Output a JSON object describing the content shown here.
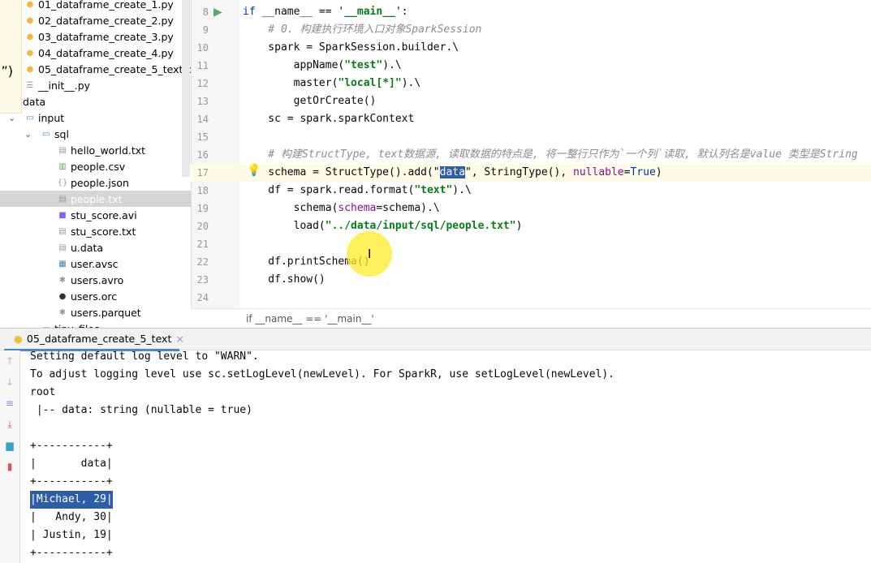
{
  "tree": [
    {
      "label": "01_dataframe_create_1.py",
      "icon": "python-file-icon",
      "indent": 30
    },
    {
      "label": "02_dataframe_create_2.py",
      "icon": "python-file-icon",
      "indent": 30
    },
    {
      "label": "03_dataframe_create_3.py",
      "icon": "python-file-icon",
      "indent": 30
    },
    {
      "label": "04_dataframe_create_4.py",
      "icon": "python-file-icon",
      "indent": 30
    },
    {
      "label": "05_dataframe_create_5_text.py",
      "icon": "python-file-icon",
      "indent": 30
    },
    {
      "label": "__init__.py",
      "icon": "init-file-icon",
      "indent": 30
    },
    {
      "label": "data",
      "icon": "",
      "indent": 28
    },
    {
      "label": "input",
      "icon": "folder-icon",
      "indent": 30,
      "expanded": true
    },
    {
      "label": "sql",
      "icon": "folder-icon",
      "indent": 50,
      "expanded": true
    },
    {
      "label": "hello_world.txt",
      "icon": "text-file-icon",
      "indent": 70
    },
    {
      "label": "people.csv",
      "icon": "csv-file-icon",
      "indent": 70
    },
    {
      "label": "people.json",
      "icon": "json-file-icon",
      "indent": 70
    },
    {
      "label": "people.txt",
      "icon": "text-file-icon",
      "indent": 70,
      "selected": true
    },
    {
      "label": "stu_score.avi",
      "icon": "video-file-icon",
      "indent": 70
    },
    {
      "label": "stu_score.txt",
      "icon": "text-file-icon",
      "indent": 70
    },
    {
      "label": "u.data",
      "icon": "text-file-icon",
      "indent": 70
    },
    {
      "label": "user.avsc",
      "icon": "avsc-file-icon",
      "indent": 70
    },
    {
      "label": "users.avro",
      "icon": "asterisk-file-icon",
      "indent": 70
    },
    {
      "label": "users.orc",
      "icon": "orc-file-icon",
      "indent": 70
    },
    {
      "label": "users.parquet",
      "icon": "asterisk-file-icon",
      "indent": 70
    },
    {
      "label": "tiny_files",
      "icon": "folder-icon",
      "indent": 50
    }
  ],
  "popup_text": "”)",
  "code": [
    {
      "n": "8",
      "t": [
        [
          "kw",
          "if "
        ],
        [
          "",
          "__name__ == "
        ],
        [
          "str",
          "'__main__'"
        ],
        [
          "",
          ":"
        ]
      ]
    },
    {
      "n": "9",
      "t": [
        [
          "cm",
          "    # 0. 构建执行环境入口对象SparkSession"
        ]
      ]
    },
    {
      "n": "10",
      "t": [
        [
          "",
          "    spark = SparkSession.builder.\\"
        ]
      ]
    },
    {
      "n": "11",
      "t": [
        [
          "",
          "        appName("
        ],
        [
          "str",
          "\"test\""
        ],
        [
          "",
          ").\\"
        ]
      ]
    },
    {
      "n": "12",
      "t": [
        [
          "",
          "        master("
        ],
        [
          "str",
          "\"local[*]\""
        ],
        [
          "",
          ").\\"
        ]
      ]
    },
    {
      "n": "13",
      "t": [
        [
          "",
          "        getOrCreate()"
        ]
      ]
    },
    {
      "n": "14",
      "t": [
        [
          "",
          "    sc = spark.sparkContext"
        ]
      ]
    },
    {
      "n": "15",
      "t": []
    },
    {
      "n": "16",
      "t": [
        [
          "cm",
          "    # 构建StructType, text数据源, 读取数据的特点是, 将一整行只作为`一个列`读取, 默认列名是value 类型是String"
        ]
      ]
    },
    {
      "n": "17",
      "t": [
        [
          "",
          "    schema = StructType().add(\""
        ],
        [
          "sel",
          "data"
        ],
        [
          "",
          "\", StringType(), "
        ],
        [
          "pr",
          "nullable"
        ],
        [
          "",
          "="
        ],
        [
          "kw",
          "True"
        ],
        [
          "",
          ")"
        ]
      ],
      "hl": true
    },
    {
      "n": "18",
      "t": [
        [
          "",
          "    df = spark.read.format("
        ],
        [
          "str",
          "\"text\""
        ],
        [
          "",
          ").\\"
        ]
      ]
    },
    {
      "n": "19",
      "t": [
        [
          "",
          "        schema("
        ],
        [
          "pr",
          "schema"
        ],
        [
          "",
          "=schema).\\"
        ]
      ]
    },
    {
      "n": "20",
      "t": [
        [
          "",
          "        load("
        ],
        [
          "str",
          "\"../data/input/sql/people.txt\""
        ],
        [
          "",
          ")"
        ]
      ]
    },
    {
      "n": "21",
      "t": []
    },
    {
      "n": "22",
      "t": [
        [
          "",
          "    df.printSchema()"
        ]
      ]
    },
    {
      "n": "23",
      "t": [
        [
          "",
          "    df.show()"
        ]
      ]
    },
    {
      "n": "24",
      "t": []
    }
  ],
  "breadcrumb": "if __name__ == '__main__'",
  "run_tab": {
    "label": "05_dataframe_create_5_text",
    "close": "×"
  },
  "console": [
    "Setting default log level to \"WARN\".",
    "To adjust logging level use sc.setLogLevel(newLevel). For SparkR, use setLogLevel(newLevel).",
    "root",
    " |-- data: string (nullable = true)",
    "",
    "+-----------+",
    "|       data|",
    "+-----------+",
    "|Michael, 29|",
    "|   Andy, 30|",
    "| Justin, 19|",
    "+-----------+"
  ],
  "console_selected_line": 8,
  "colors": {
    "accent": "#4a88c7",
    "selection": "#2d5ca8",
    "string": "#067d17",
    "keyword": "#0033b3",
    "run": "#59a869"
  }
}
